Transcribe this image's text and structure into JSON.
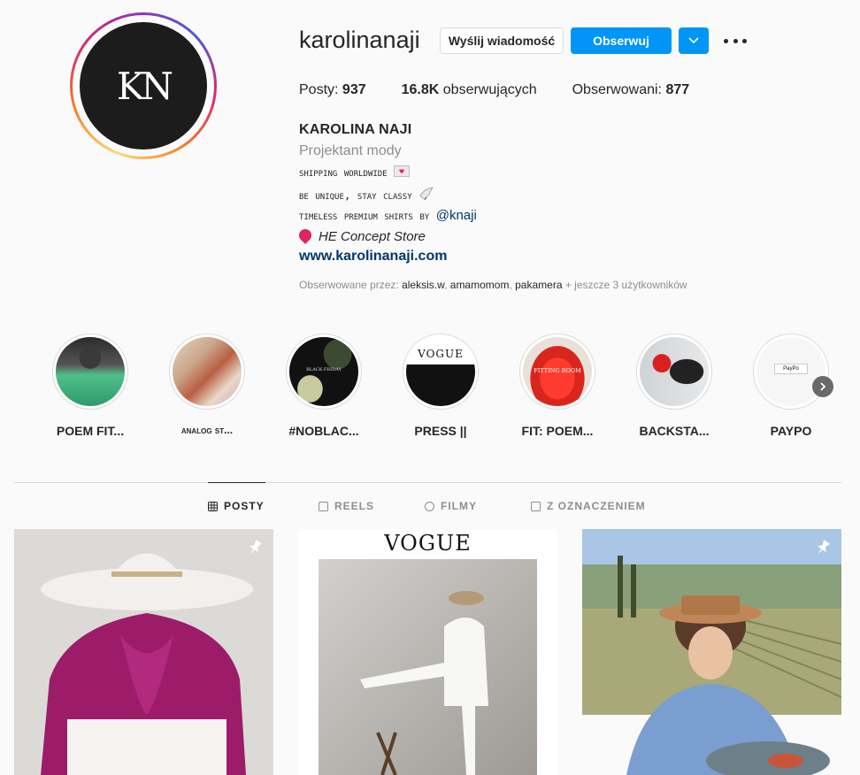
{
  "profile": {
    "avatar_text": "KN",
    "username": "karolinanaji",
    "message_label": "Wyślij wiadomość",
    "follow_label": "Obserwuj"
  },
  "stats": {
    "posts_label": "Posty:",
    "posts_value": "937",
    "followers_value": "16.8K",
    "followers_label": "obserwujących",
    "following_label": "Obserwowani:",
    "following_value": "877"
  },
  "bio": {
    "full_name": "KAROLINA NAJI",
    "category": "Projektant mody",
    "line1": "shipping worldwide",
    "line2": "be unique, stay classy",
    "line3": "timeless premium shirts by",
    "line3_mention": "@knaji",
    "location": "HE Concept Store",
    "website": "www.karolinanaji.com",
    "followed_by_label": "Obserwowane przez:",
    "followed_by_1": "aleksis.w",
    "followed_by_2": "amamomom",
    "followed_by_3": "pakamera",
    "followed_by_more": "+ jeszcze 3 użytkowników"
  },
  "highlights": [
    {
      "label": "POEM FIT..."
    },
    {
      "label": "analog st..."
    },
    {
      "label": "#NOBLAC..."
    },
    {
      "label": "PRESS ||"
    },
    {
      "label": "FIT: POEM..."
    },
    {
      "label": "BACKSTA..."
    },
    {
      "label": "PAYPO"
    }
  ],
  "highlight_art": {
    "vogue": "VOGUE",
    "black_friday": "BLACK FRIDAY",
    "fitting_room": "FITTING ROOM",
    "paypo": "PayPo"
  },
  "tabs": [
    {
      "label": "POSTY"
    },
    {
      "label": "REELS"
    },
    {
      "label": "FILMY"
    },
    {
      "label": "Z OZNACZENIEM"
    }
  ],
  "posts": {
    "vogue_title": "VOGUE"
  }
}
